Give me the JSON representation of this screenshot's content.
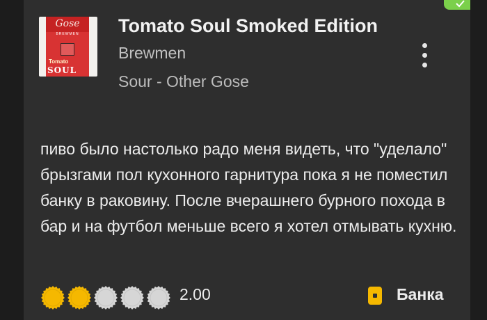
{
  "checkin": {
    "beer_name": "Tomato Soul Smoked Edition",
    "brewery": "Brewmen",
    "style": "Sour - Other Gose",
    "logo": {
      "script_text": "Gose",
      "brand_text": "BREWMEN",
      "name_line1": "Tomato",
      "name_line2": "SOUL"
    },
    "review_text": "пиво было настолько радо меня видеть, что \"уделало\" брызгами пол кухонного гарнитура пока я не поместил банку в раковину. После вчерашнего бурного похода в бар и на футбол меньше всего я хотел отмывать кухню.",
    "rating": {
      "value": 2.0,
      "value_text": "2.00",
      "max_caps": 5
    },
    "serving": {
      "label": "Банка",
      "icon": "can-icon"
    }
  },
  "icons": {
    "menu": "more-vertical-icon",
    "verified": "check-icon"
  },
  "colors": {
    "background": "#2e2e2e",
    "cap_filled": "#f5b800",
    "cap_empty": "#d6d6d6",
    "can_icon": "#f5b800",
    "verified_badge": "#7bd04b"
  }
}
